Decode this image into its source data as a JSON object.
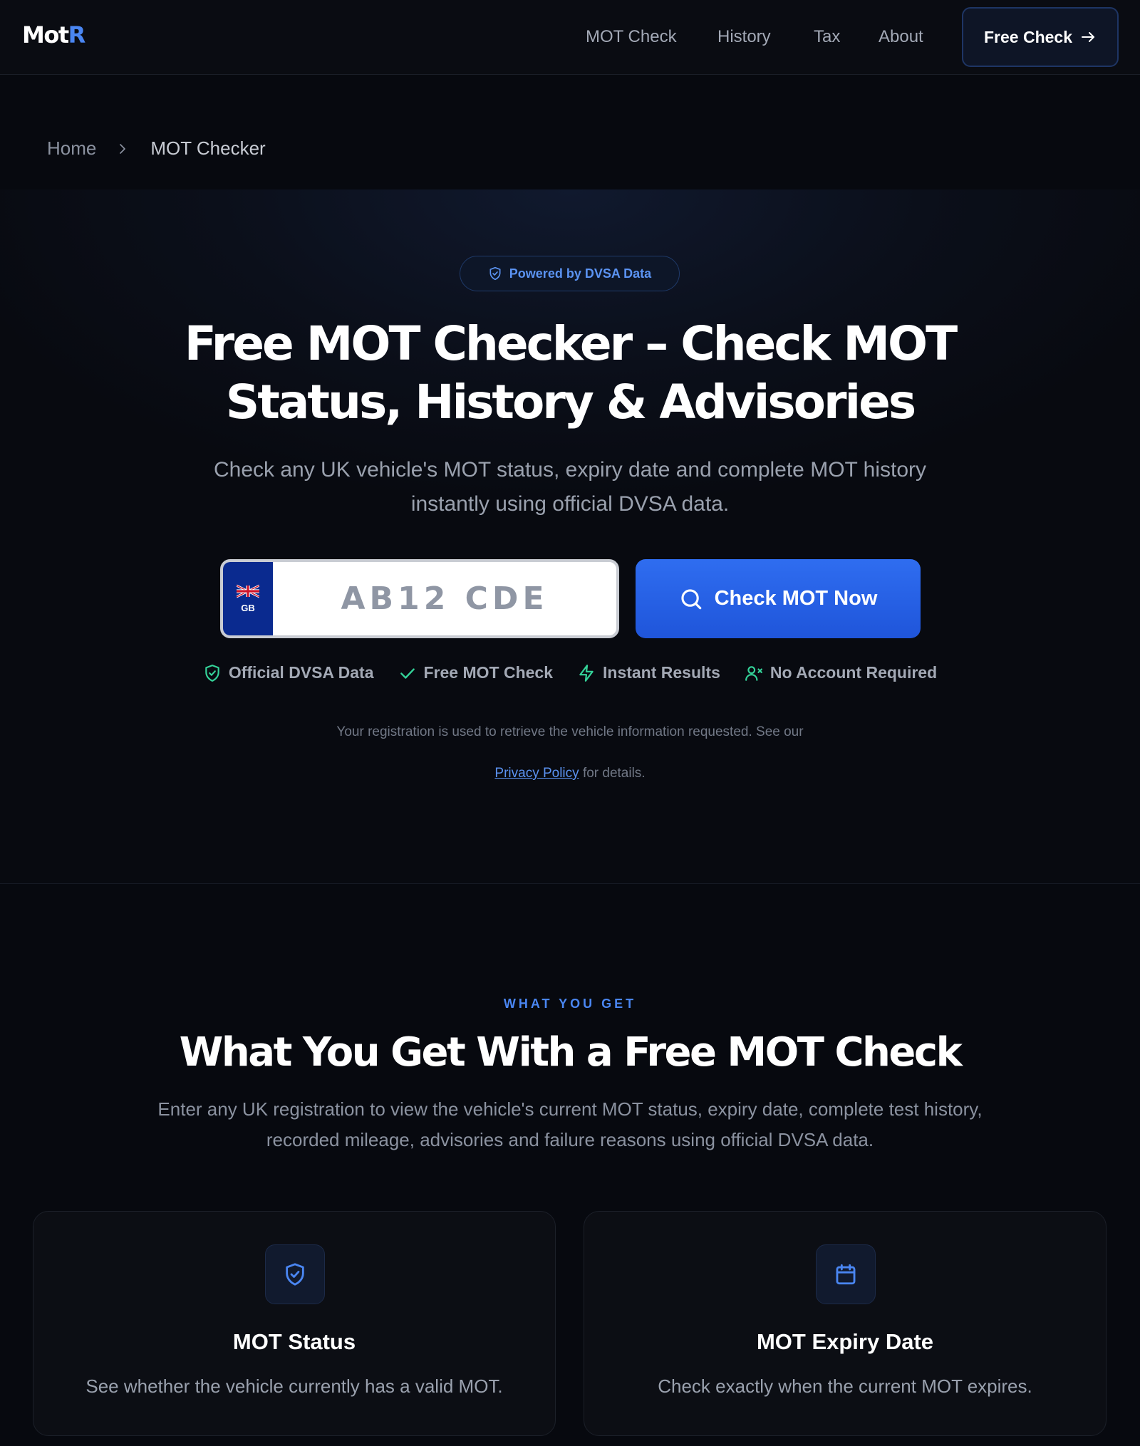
{
  "header": {
    "logo": {
      "main": "Mot",
      "accent": "R"
    },
    "nav": [
      "MOT Check",
      "History",
      "Tax",
      "About"
    ],
    "cta": "Free Check"
  },
  "breadcrumb": {
    "home": "Home",
    "current": "MOT Checker"
  },
  "hero": {
    "badge": "Powered by DVSA Data",
    "title_line1": "Free MOT Checker – Check MOT",
    "title_line2": "Status, History & Advisories",
    "subtitle_line1": "Check any UK vehicle's MOT status, expiry date and complete MOT history",
    "subtitle_line2": "instantly using official DVSA data.",
    "plate_country": "GB",
    "plate_placeholder": "AB12 CDE",
    "check_button": "Check MOT Now",
    "features": [
      "Official DVSA Data",
      "Free MOT Check",
      "Instant Results",
      "No Account Required"
    ],
    "disclaimer_line1": "Your registration is used to retrieve the vehicle information requested. See our",
    "privacy_link": "Privacy Policy",
    "disclaimer_line2_suffix": "for details."
  },
  "section": {
    "eyebrow": "WHAT YOU GET",
    "title": "What You Get With a Free MOT Check",
    "subtitle_line1": "Enter any UK registration to view the vehicle's current MOT status, expiry date, complete test history,",
    "subtitle_line2": "recorded mileage, advisories and failure reasons using official DVSA data.",
    "cards": [
      {
        "icon": "shield-check-icon",
        "title": "MOT Status",
        "text": "See whether the vehicle currently has a valid MOT."
      },
      {
        "icon": "calendar-icon",
        "title": "MOT Expiry Date",
        "text": "Check exactly when the current MOT expires."
      }
    ]
  },
  "colors": {
    "accent": "#4a86f2",
    "button": "#2563eb",
    "success": "#34d399",
    "background": "#07090f"
  }
}
